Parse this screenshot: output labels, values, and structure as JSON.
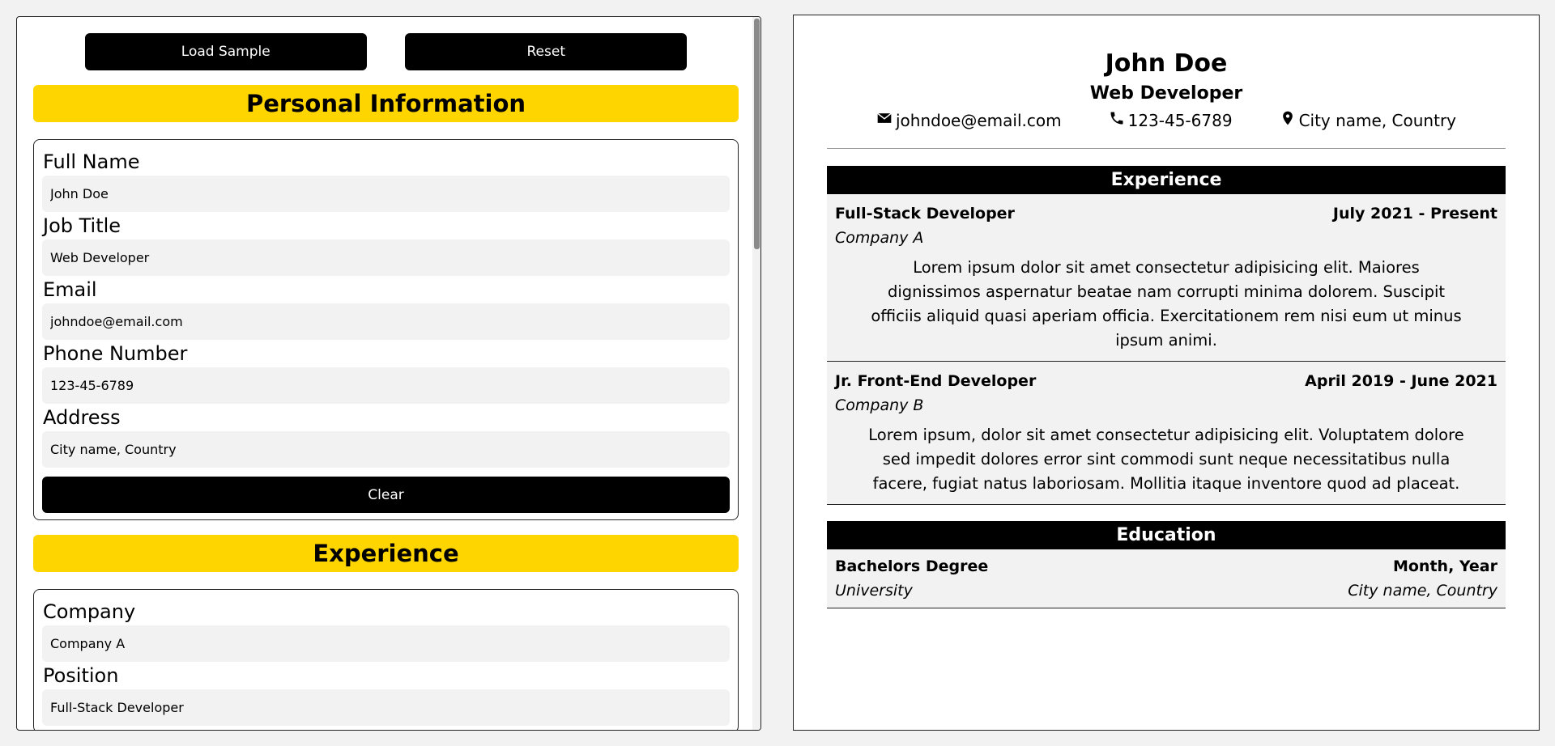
{
  "toolbar": {
    "load_sample": "Load Sample",
    "reset": "Reset"
  },
  "personal": {
    "heading": "Personal Information",
    "fields": [
      {
        "label": "Full Name",
        "value": "John Doe"
      },
      {
        "label": "Job Title",
        "value": "Web Developer"
      },
      {
        "label": "Email",
        "value": "johndoe@email.com"
      },
      {
        "label": "Phone Number",
        "value": "123-45-6789"
      },
      {
        "label": "Address",
        "value": "City name, Country"
      }
    ],
    "clear_label": "Clear"
  },
  "experience_form": {
    "heading": "Experience",
    "fields": [
      {
        "label": "Company",
        "value": "Company A"
      },
      {
        "label": "Position",
        "value": "Full-Stack Developer"
      }
    ]
  },
  "cv": {
    "name": "John Doe",
    "title": "Web Developer",
    "contact": {
      "email": "johndoe@email.com",
      "phone": "123-45-6789",
      "address": "City name, Country",
      "email_icon": "mail-icon",
      "phone_icon": "phone-icon",
      "address_icon": "location-pin-icon"
    },
    "experience_heading": "Experience",
    "experience": [
      {
        "position": "Full-Stack Developer",
        "dates": "July 2021 - Present",
        "company": "Company A",
        "description": "Lorem ipsum dolor sit amet consectetur adipisicing elit. Maiores dignissimos aspernatur beatae nam corrupti minima dolorem. Suscipit officiis aliquid quasi aperiam officia. Exercitationem rem nisi eum ut minus ipsum animi."
      },
      {
        "position": "Jr. Front-End Developer",
        "dates": "April 2019 - June 2021",
        "company": "Company B",
        "description": "Lorem ipsum, dolor sit amet consectetur adipisicing elit. Voluptatem dolore sed impedit dolores error sint commodi sunt neque necessitatibus nulla facere, fugiat natus laboriosam. Mollitia itaque inventore quod ad placeat."
      }
    ],
    "education_heading": "Education",
    "education": [
      {
        "degree": "Bachelors Degree",
        "date": "Month, Year",
        "school": "University",
        "location": "City name, Country"
      }
    ]
  },
  "colors": {
    "accent": "#ffd500",
    "dark": "#000000",
    "field_bg": "#f2f2f2",
    "page_bg": "#f2f2f2"
  }
}
